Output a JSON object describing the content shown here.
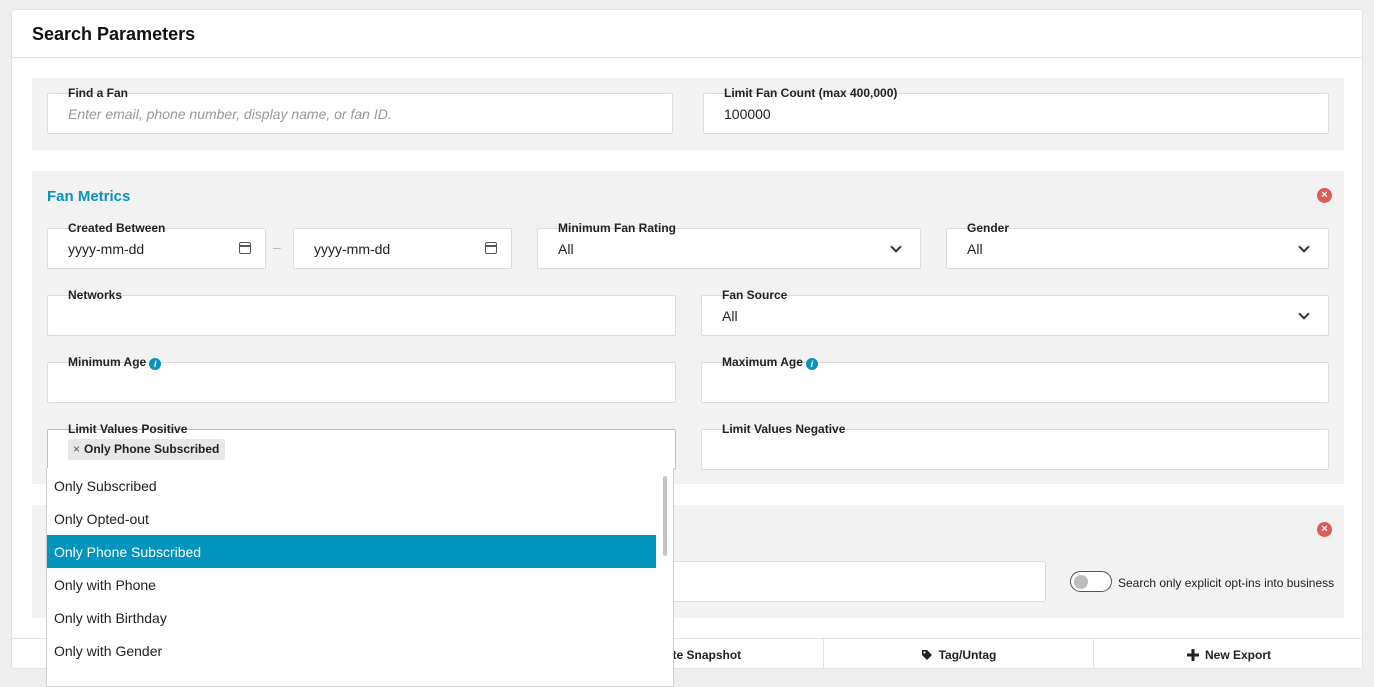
{
  "title": "Search Parameters",
  "find_fan": {
    "label": "Find a Fan",
    "placeholder": "Enter email, phone number, display name, or fan ID."
  },
  "limit_count": {
    "label": "Limit Fan Count (max 400,000)",
    "value": "100000"
  },
  "fan_metrics": {
    "title": "Fan Metrics",
    "created_between": {
      "label": "Created Between",
      "start": "yyyy-mm-dd",
      "end": "yyyy-mm-dd",
      "separator": "–"
    },
    "min_rating": {
      "label": "Minimum Fan Rating",
      "value": "All"
    },
    "gender": {
      "label": "Gender",
      "value": "All"
    },
    "networks": {
      "label": "Networks"
    },
    "fan_source": {
      "label": "Fan Source",
      "value": "All"
    },
    "min_age": {
      "label": "Minimum Age"
    },
    "max_age": {
      "label": "Maximum Age"
    },
    "limit_positive": {
      "label": "Limit Values Positive",
      "tag": "Only Phone Subscribed",
      "tag_remove": "×"
    },
    "limit_negative": {
      "label": "Limit Values Negative"
    }
  },
  "dropdown": {
    "options": [
      "Only Subscribed",
      "Only Opted-out",
      "Only Phone Subscribed",
      "Only with Phone",
      "Only with Birthday",
      "Only with Gender"
    ],
    "highlighted": "Only Phone Subscribed"
  },
  "second_section": {
    "toggle_label": "Search only explicit opt-ins into business"
  },
  "footer": {
    "snapshot_label": "ate Snapshot",
    "tag_label": "Tag/Untag",
    "export_label": "New Export"
  },
  "colors": {
    "accent": "#0a93ba",
    "selected_bg": "#0195bd",
    "remove": "#e05a5a"
  }
}
